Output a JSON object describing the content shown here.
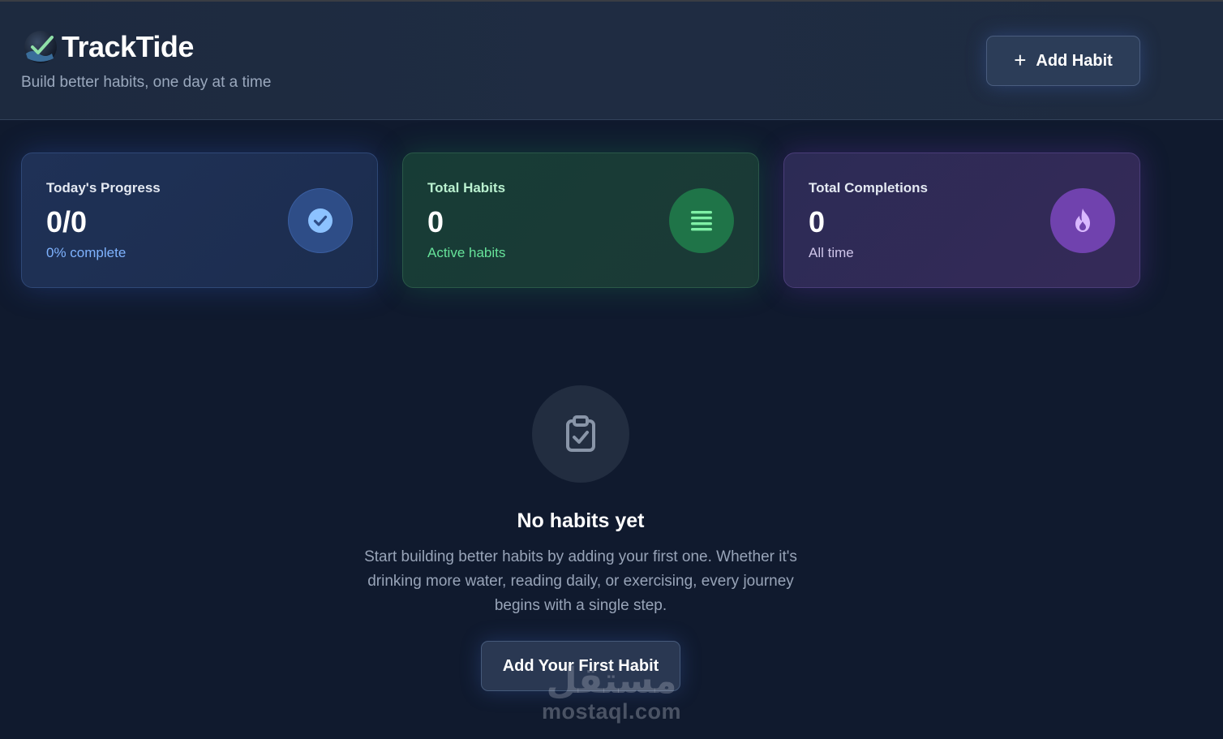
{
  "header": {
    "title": "TrackTide",
    "tagline": "Build better habits, one day at a time",
    "logo_icon": "wave-check-logo-icon",
    "add_button": {
      "icon": "plus-icon",
      "label": "Add Habit"
    }
  },
  "stats": [
    {
      "label": "Today's Progress",
      "value": "0/0",
      "sub": "0% complete",
      "icon": "check-circle-icon",
      "accent": "#7fb3ff"
    },
    {
      "label": "Total Habits",
      "value": "0",
      "sub": "Active habits",
      "icon": "list-icon",
      "accent": "#66e39a"
    },
    {
      "label": "Total Completions",
      "value": "0",
      "sub": "All time",
      "icon": "fire-icon",
      "accent": "#c9a7ff"
    }
  ],
  "empty_state": {
    "icon": "clipboard-check-icon",
    "title": "No habits yet",
    "text": "Start building better habits by adding your first one. Whether it's drinking more water, reading daily, or exercising, every journey begins with a single step.",
    "button_label": "Add Your First Habit"
  },
  "watermark": {
    "arabic": "مستقل",
    "latin": "mostaql.com"
  },
  "colors": {
    "background": "#101a2e",
    "header": "#1f2c42",
    "button": "#2c3d58"
  }
}
